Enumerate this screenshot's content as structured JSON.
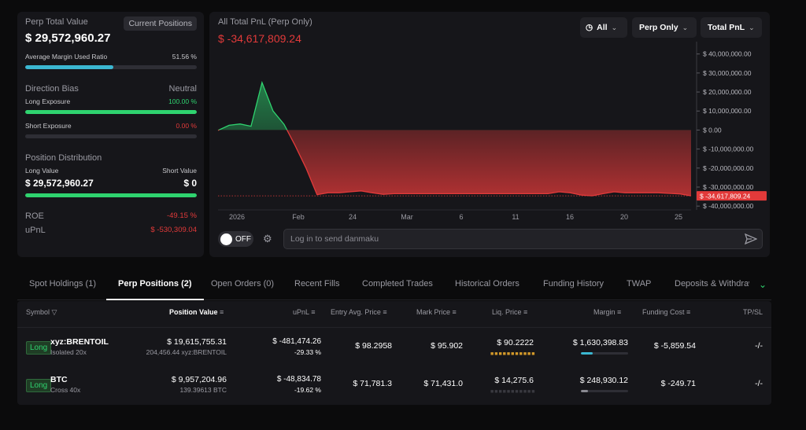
{
  "summary": {
    "perp_total_value_label": "Perp Total Value",
    "current_positions_label": "Current Positions",
    "perp_total_value": "$ 29,572,960.27",
    "avg_margin_label": "Average Margin Used Ratio",
    "avg_margin_value": "51.56 %",
    "avg_margin_fraction": 0.5156,
    "direction_bias_label": "Direction Bias",
    "direction_bias_value": "Neutral",
    "long_exposure_label": "Long Exposure",
    "long_exposure_value": "100.00 %",
    "long_exposure_fraction": 1.0,
    "short_exposure_label": "Short Exposure",
    "short_exposure_value": "0.00 %",
    "short_exposure_fraction": 0.0,
    "position_distribution_label": "Position Distribution",
    "long_value_label": "Long Value",
    "short_value_label": "Short Value",
    "long_value": "$ 29,572,960.27",
    "short_value": "$ 0",
    "long_value_fraction": 1.0,
    "roe_label": "ROE",
    "roe_value": "-49.15 %",
    "upnl_label": "uPnL",
    "upnl_value": "$ -530,309.04"
  },
  "chart_panel": {
    "title": "All Total PnL (Perp Only)",
    "current_value": "$ -34,617,809.24",
    "filters": {
      "range": "All",
      "scope": "Perp Only",
      "metric": "Total PnL"
    },
    "danmaku_toggle": "OFF",
    "danmaku_placeholder": "Log in to send danmaku"
  },
  "chart_data": {
    "type": "area",
    "x_tick_labels": [
      "2026",
      "Feb",
      "24",
      "Mar",
      "6",
      "11",
      "16",
      "20",
      "25"
    ],
    "y_tick_labels": [
      "$ 40,000,000.00",
      "$ 30,000,000.00",
      "$ 20,000,000.00",
      "$ 10,000,000.00",
      "$ 0.00",
      "$ -10,000,000.00",
      "$ -20,000,000.00",
      "$ -30,000,000.00",
      "$ -40,000,000.00"
    ],
    "y_ticks": [
      40000000,
      30000000,
      20000000,
      10000000,
      0,
      -10000000,
      -20000000,
      -30000000,
      -40000000
    ],
    "ylim": [
      -42000000,
      44000000
    ],
    "current_label": "$ -34,617,809.24",
    "current_value": -34617809.24,
    "positive_color": "#2fd36f",
    "negative_color": "#e23a3a",
    "values": [
      -200000,
      2500000,
      3200000,
      2000000,
      25000000,
      10000000,
      3000000,
      -8000000,
      -20000000,
      -34000000,
      -33000000,
      -33000000,
      -32500000,
      -32000000,
      -33000000,
      -33800000,
      -33500000,
      -33500000,
      -33500000,
      -33500000,
      -33500000,
      -33500000,
      -33500000,
      -33500000,
      -33500000,
      -33500000,
      -33500000,
      -33500000,
      -33500000,
      -33500000,
      -33500000,
      -32500000,
      -33000000,
      -34200000,
      -34600000,
      -33500000,
      -32500000,
      -33000000,
      -33000000,
      -33000000,
      -33000000,
      -33300000,
      -33600000,
      -34617809.24
    ]
  },
  "tabs": [
    {
      "label": "Spot Holdings (1)"
    },
    {
      "label": "Perp Positions (2)"
    },
    {
      "label": "Open Orders (0)"
    },
    {
      "label": "Recent Fills"
    },
    {
      "label": "Completed Trades"
    },
    {
      "label": "Historical Orders"
    },
    {
      "label": "Funding History"
    },
    {
      "label": "TWAP"
    },
    {
      "label": "Deposits & Withdraw"
    }
  ],
  "table": {
    "headers": {
      "symbol": "Symbol",
      "position_value": "Position Value",
      "upnl": "uPnL",
      "entry": "Entry Avg. Price",
      "mark": "Mark Price",
      "liq": "Liq. Price",
      "margin": "Margin",
      "funding": "Funding Cost",
      "tpsl": "TP/SL"
    },
    "rows": [
      {
        "side": "Long",
        "symbol": "xyz:BRENTOIL",
        "margin_mode": "Isolated 20x",
        "position_value": "$ 19,615,755.31",
        "position_size": "204,456.44 xyz:BRENTOIL",
        "upnl": "$ -481,474.26",
        "upnl_pct": "-29.33 %",
        "entry": "$ 98.2958",
        "mark": "$ 95.902",
        "liq": "$ 90.2222",
        "margin": "$ 1,630,398.83",
        "margin_fraction": 0.25,
        "funding": "$ -5,859.54",
        "tpsl": "-/-"
      },
      {
        "side": "Long",
        "symbol": "BTC",
        "margin_mode": "Cross 40x",
        "position_value": "$ 9,957,204.96",
        "position_size": "139.39613 BTC",
        "upnl": "$ -48,834.78",
        "upnl_pct": "-19.62 %",
        "entry": "$ 71,781.3",
        "mark": "$ 71,431.0",
        "liq": "$ 14,275.6",
        "margin": "$ 248,930.12",
        "margin_fraction": 0.15,
        "funding": "$ -249.71",
        "tpsl": "-/-"
      }
    ]
  }
}
